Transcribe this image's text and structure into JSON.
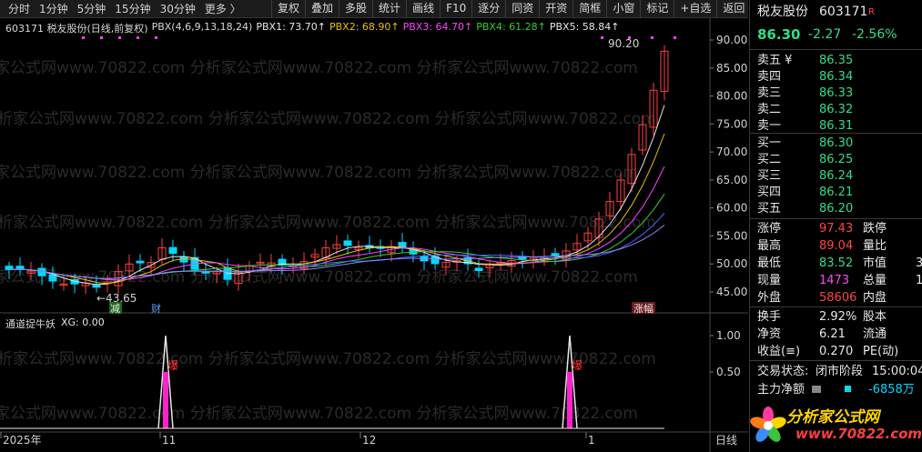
{
  "toolbar": {
    "periods": [
      "分时",
      "1分钟",
      "5分钟",
      "15分钟",
      "30分钟",
      "更多 〉"
    ],
    "buttons": [
      "复权",
      "叠加",
      "多股",
      "统计",
      "画线",
      "F10",
      "逐分",
      "同资",
      "开资",
      "简框",
      "小窗",
      "标记",
      "+自选",
      "返回"
    ]
  },
  "main_legend": {
    "stock": "603171 税友股份(日线,前复权)",
    "indicator": "PBX(4,6,9,13,18,24)",
    "pbx1": "PBX1: 73.70↑",
    "pbx2": "PBX2: 68.90↑",
    "pbx3": "PBX3: 64.70↑",
    "pbx4": "PBX4: 61.28↑",
    "pbx5": "PBX5: 58.84↑"
  },
  "sub_legend": {
    "name": "通道捉牛妖",
    "xg": "XG: 0.00"
  },
  "markers": {
    "low_label": "←43.65",
    "high_label": "90.20",
    "jian": "减",
    "cai": "财",
    "zhangfu": "涨幅",
    "bao": "爆"
  },
  "axis": {
    "price_ticks": [
      "90.00",
      "85.00",
      "80.00",
      "75.00",
      "70.00",
      "65.00",
      "60.00",
      "55.00",
      "50.00",
      "45.00"
    ],
    "sub_ticks": [
      "1.00",
      "0.50"
    ],
    "date_labels": [
      "2025年",
      "11",
      "12",
      "1"
    ],
    "corner": "日线"
  },
  "watermark": "分析家公式网www.70822.com",
  "quote": {
    "name": "税友股份",
    "code": "603171",
    "badge": "R",
    "price": "86.30",
    "change": "-2.27",
    "pct": "-2.56%",
    "asks": [
      {
        "label": "卖五 ¥",
        "price": "86.35"
      },
      {
        "label": "卖四",
        "price": "86.34"
      },
      {
        "label": "卖三",
        "price": "86.33"
      },
      {
        "label": "卖二",
        "price": "86.32"
      },
      {
        "label": "卖一",
        "price": "86.31"
      }
    ],
    "bids": [
      {
        "label": "买一",
        "price": "86.30"
      },
      {
        "label": "买二",
        "price": "86.25"
      },
      {
        "label": "买三",
        "price": "86.24"
      },
      {
        "label": "买四",
        "price": "86.21"
      },
      {
        "label": "买五",
        "price": "86.20"
      }
    ],
    "stats": [
      {
        "label": "涨停",
        "value": "97.43",
        "label2": "跌停"
      },
      {
        "label": "最高",
        "value": "89.04",
        "label2": "量比"
      },
      {
        "label": "最低",
        "value": "83.52",
        "label2": "市值",
        "extra": "3"
      },
      {
        "label": "现量",
        "value": "1473",
        "label2": "总量",
        "extra": "1"
      },
      {
        "label": "外盘",
        "value": "58606",
        "label2": "内盘"
      }
    ],
    "fin": [
      {
        "label": "换手",
        "value": "2.92%",
        "label2": "股本"
      },
      {
        "label": "净资",
        "value": "6.21",
        "label2": "流通"
      },
      {
        "label": "收益(≡)",
        "value": "0.270",
        "label2": "PE(动)"
      }
    ],
    "trade_state_label": "交易状态:",
    "trade_state": "闭市阶段",
    "trade_time": "15:00:04",
    "main_net_label": "主力净额",
    "main_net_value": "-6858万",
    "logo_text": "分析家公式网",
    "logo_url": "www.70822.com"
  }
}
